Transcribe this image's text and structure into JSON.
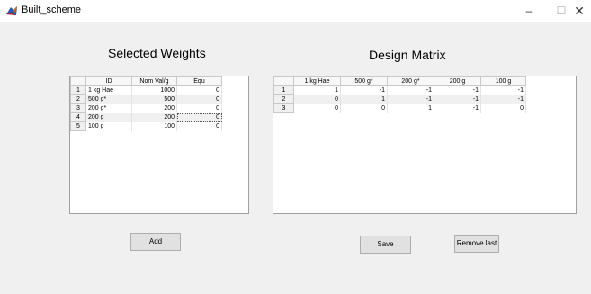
{
  "window": {
    "title": "Built_scheme",
    "minimize_glyph": "–",
    "maximize_glyph": "☐",
    "close_glyph": "✕"
  },
  "selected_weights": {
    "title": "Selected Weights",
    "columns": [
      "ID",
      "Nom Val/g",
      "Equ"
    ],
    "rows": [
      {
        "index": "1",
        "id": "1 kg Hae",
        "nom_val": "1000",
        "equ": "0"
      },
      {
        "index": "2",
        "id": "500 g*",
        "nom_val": "500",
        "equ": "0"
      },
      {
        "index": "3",
        "id": "200 g*",
        "nom_val": "200",
        "equ": "0"
      },
      {
        "index": "4",
        "id": "200 g",
        "nom_val": "200",
        "equ": "0"
      },
      {
        "index": "5",
        "id": "100 g",
        "nom_val": "100",
        "equ": "0"
      }
    ]
  },
  "design_matrix": {
    "title": "Design Matrix",
    "columns": [
      "1 kg Hae",
      "500 g*",
      "200 g*",
      "200 g",
      "100 g"
    ],
    "rows": [
      {
        "index": "1",
        "values": [
          "1",
          "-1",
          "-1",
          "-1",
          "-1"
        ]
      },
      {
        "index": "2",
        "values": [
          "0",
          "1",
          "-1",
          "-1",
          "-1"
        ]
      },
      {
        "index": "3",
        "values": [
          "0",
          "0",
          "1",
          "-1",
          "0"
        ]
      }
    ]
  },
  "buttons": {
    "add": "Add",
    "save": "Save",
    "remove_last": "Remove last"
  }
}
